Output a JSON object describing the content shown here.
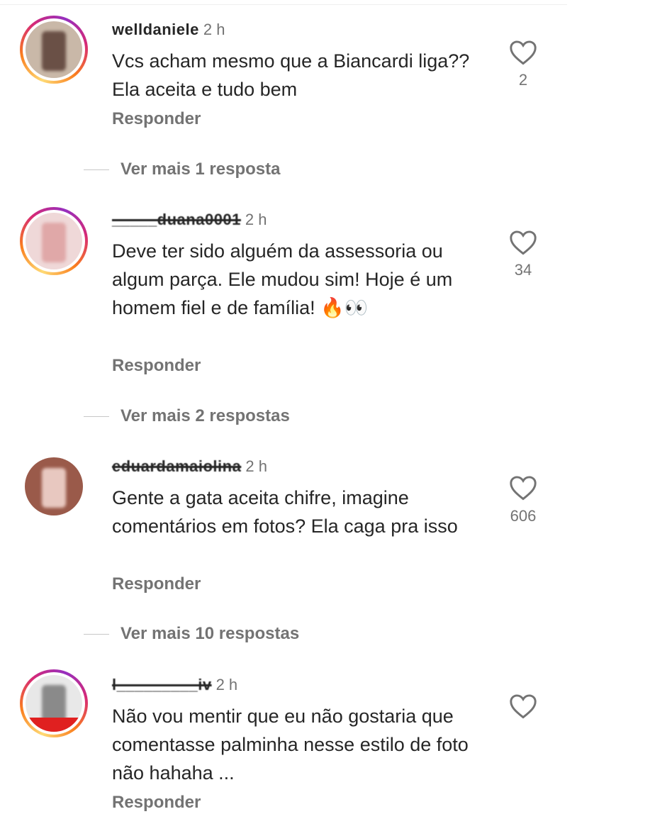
{
  "comments": [
    {
      "username": "welldaniele",
      "time": "2 h",
      "text": "Vcs acham mesmo que a Biancardi liga?? Ela aceita e tudo bem",
      "reply_label": "Responder",
      "likes": "2",
      "more_replies": "Ver mais 1 resposta",
      "avatar_color": "#8a6a5a"
    },
    {
      "username": "_____duana0001",
      "time": "2 h",
      "text": "Deve ter sido alguém da assessoria ou algum parça. Ele mudou sim! Hoje é um homem fiel e de família! 🔥👀",
      "reply_label": "Responder",
      "likes": "34",
      "more_replies": "Ver mais 2 respostas",
      "avatar_color": "#e8b0b0"
    },
    {
      "username": "eduardamaiolina",
      "time": "2 h",
      "text": "Gente a gata aceita chifre, imagine comentários em fotos? Ela caga pra isso",
      "reply_label": "Responder",
      "likes": "606",
      "more_replies": "Ver mais 10 respostas",
      "avatar_color": "#b07a6a"
    },
    {
      "username": "l_________iv",
      "time": "2 h",
      "text": "Não vou mentir que eu não gostaria que comentasse palminha nesse estilo de foto não hahaha ...",
      "reply_label": "Responder",
      "likes": "",
      "avatar_color": "#c0c0c0"
    }
  ],
  "icons": {
    "like": "heart-outline-icon"
  }
}
